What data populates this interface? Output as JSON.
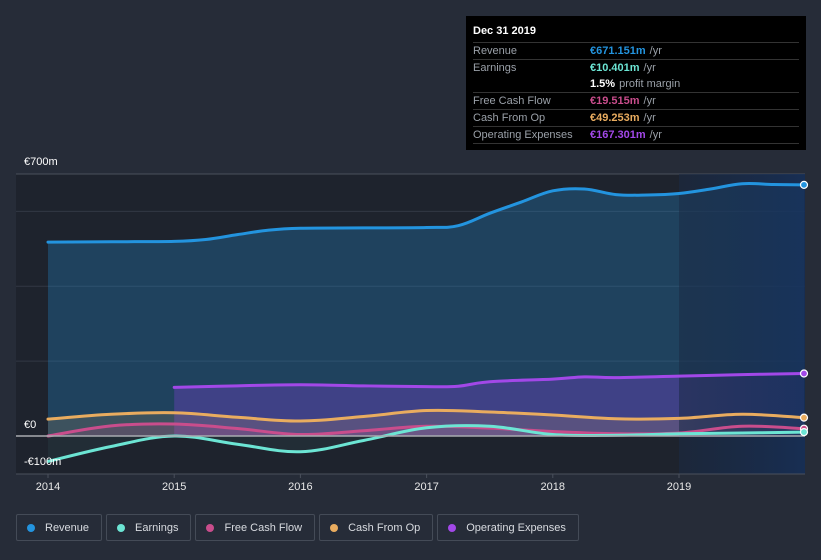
{
  "tooltip": {
    "date": "Dec 31 2019",
    "rows": [
      {
        "label": "Revenue",
        "value": "€671.151m",
        "unit": "/yr",
        "color": "#2394df"
      },
      {
        "label": "Earnings",
        "value": "€10.401m",
        "unit": "/yr",
        "color": "#6ce5d4"
      },
      {
        "label": "",
        "value": "1.5%",
        "unit": "profit margin",
        "color": "#ffffff"
      },
      {
        "label": "Free Cash Flow",
        "value": "€19.515m",
        "unit": "/yr",
        "color": "#c94d8c"
      },
      {
        "label": "Cash From Op",
        "value": "€49.253m",
        "unit": "/yr",
        "color": "#e9ac5f"
      },
      {
        "label": "Operating Expenses",
        "value": "€167.301m",
        "unit": "/yr",
        "color": "#a248e8"
      }
    ]
  },
  "legend": [
    {
      "label": "Revenue",
      "color": "#2394df"
    },
    {
      "label": "Earnings",
      "color": "#6ce5d4"
    },
    {
      "label": "Free Cash Flow",
      "color": "#c94d8c"
    },
    {
      "label": "Cash From Op",
      "color": "#e9ac5f"
    },
    {
      "label": "Operating Expenses",
      "color": "#a248e8"
    }
  ],
  "chart_data": {
    "type": "area",
    "title": "",
    "xlabel": "",
    "ylabel": "",
    "y_tick_labels": [
      "€700m",
      "€0",
      "-€100m"
    ],
    "x_tick_labels": [
      "2014",
      "2015",
      "2016",
      "2017",
      "2018",
      "2019"
    ],
    "ylim": [
      -100,
      700
    ],
    "xlim": [
      2013.75,
      2020.0
    ],
    "grid": true,
    "legend_position": "bottom",
    "highlight_from": 2019.0,
    "series": [
      {
        "name": "Revenue",
        "color": "#2394df",
        "x": [
          2014.0,
          2014.5,
          2015.0,
          2015.25,
          2015.5,
          2015.75,
          2016.0,
          2016.5,
          2017.0,
          2017.25,
          2017.5,
          2017.75,
          2018.0,
          2018.25,
          2018.5,
          2018.75,
          2019.0,
          2019.25,
          2019.5,
          2019.75,
          2020.0
        ],
        "values": [
          518,
          519,
          520,
          525,
          538,
          550,
          555,
          556,
          557,
          562,
          595,
          625,
          655,
          660,
          645,
          644,
          648,
          660,
          674,
          672,
          671
        ]
      },
      {
        "name": "Operating Expenses",
        "color": "#a248e8",
        "x": [
          2015.0,
          2015.5,
          2016.0,
          2016.5,
          2017.0,
          2017.25,
          2017.5,
          2018.0,
          2018.25,
          2018.5,
          2019.0,
          2019.5,
          2020.0
        ],
        "values": [
          130,
          134,
          137,
          134,
          132,
          133,
          145,
          152,
          158,
          156,
          160,
          164,
          167
        ]
      },
      {
        "name": "Cash From Op",
        "color": "#e9ac5f",
        "x": [
          2014.0,
          2014.5,
          2015.0,
          2015.5,
          2016.0,
          2016.5,
          2017.0,
          2017.5,
          2018.0,
          2018.5,
          2019.0,
          2019.5,
          2020.0
        ],
        "values": [
          45,
          58,
          62,
          50,
          40,
          52,
          68,
          64,
          56,
          46,
          47,
          58,
          49
        ]
      },
      {
        "name": "Free Cash Flow",
        "color": "#c94d8c",
        "x": [
          2014.0,
          2014.5,
          2015.0,
          2015.5,
          2016.0,
          2016.5,
          2017.0,
          2017.5,
          2018.0,
          2018.5,
          2019.0,
          2019.5,
          2020.0
        ],
        "values": [
          0,
          27,
          32,
          20,
          4,
          14,
          26,
          21,
          12,
          6,
          8,
          26,
          19.5
        ]
      },
      {
        "name": "Earnings",
        "color": "#6ce5d4",
        "x": [
          2014.0,
          2014.5,
          2015.0,
          2015.5,
          2016.0,
          2016.5,
          2017.0,
          2017.5,
          2018.0,
          2018.5,
          2019.0,
          2019.5,
          2020.0
        ],
        "values": [
          -68,
          -28,
          0,
          -22,
          -42,
          -12,
          22,
          26,
          4,
          2,
          6,
          8,
          10.4
        ]
      }
    ]
  }
}
